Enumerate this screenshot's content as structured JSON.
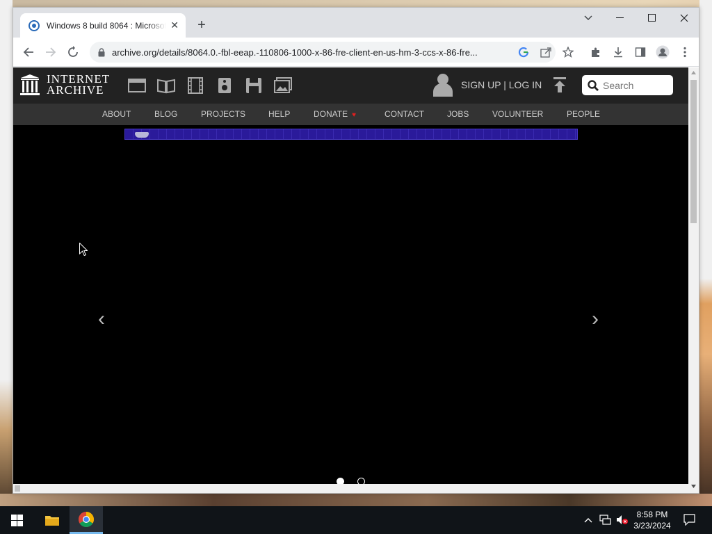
{
  "browser": {
    "tab_title": "Windows 8 build 8064 : Microsoft",
    "url": "archive.org/details/8064.0.-fbl-eeap.-110806-1000-x-86-fre-client-en-us-hm-3-ccs-x-86-fre..."
  },
  "ia": {
    "logo_line1": "INTERNET",
    "logo_line2": "ARCHIVE",
    "media_icons": [
      "web-icon",
      "texts-icon",
      "video-icon",
      "audio-icon",
      "software-icon",
      "images-icon"
    ],
    "auth": "SIGN UP | LOG IN",
    "search_placeholder": "Search",
    "nav": [
      "ABOUT",
      "BLOG",
      "PROJECTS",
      "HELP",
      "DONATE",
      "CONTACT",
      "JOBS",
      "VOLUNTEER",
      "PEOPLE"
    ]
  },
  "carousel": {
    "prev": "‹",
    "next": "›",
    "slides": 2,
    "active_slide": 1
  },
  "taskbar": {
    "time": "8:58 PM",
    "date": "3/23/2024"
  },
  "colors": {
    "header_bg": "#222222",
    "nav_bg": "#333333",
    "emulator_bar": "#2a1a9a",
    "donate_heart": "#e02020"
  }
}
